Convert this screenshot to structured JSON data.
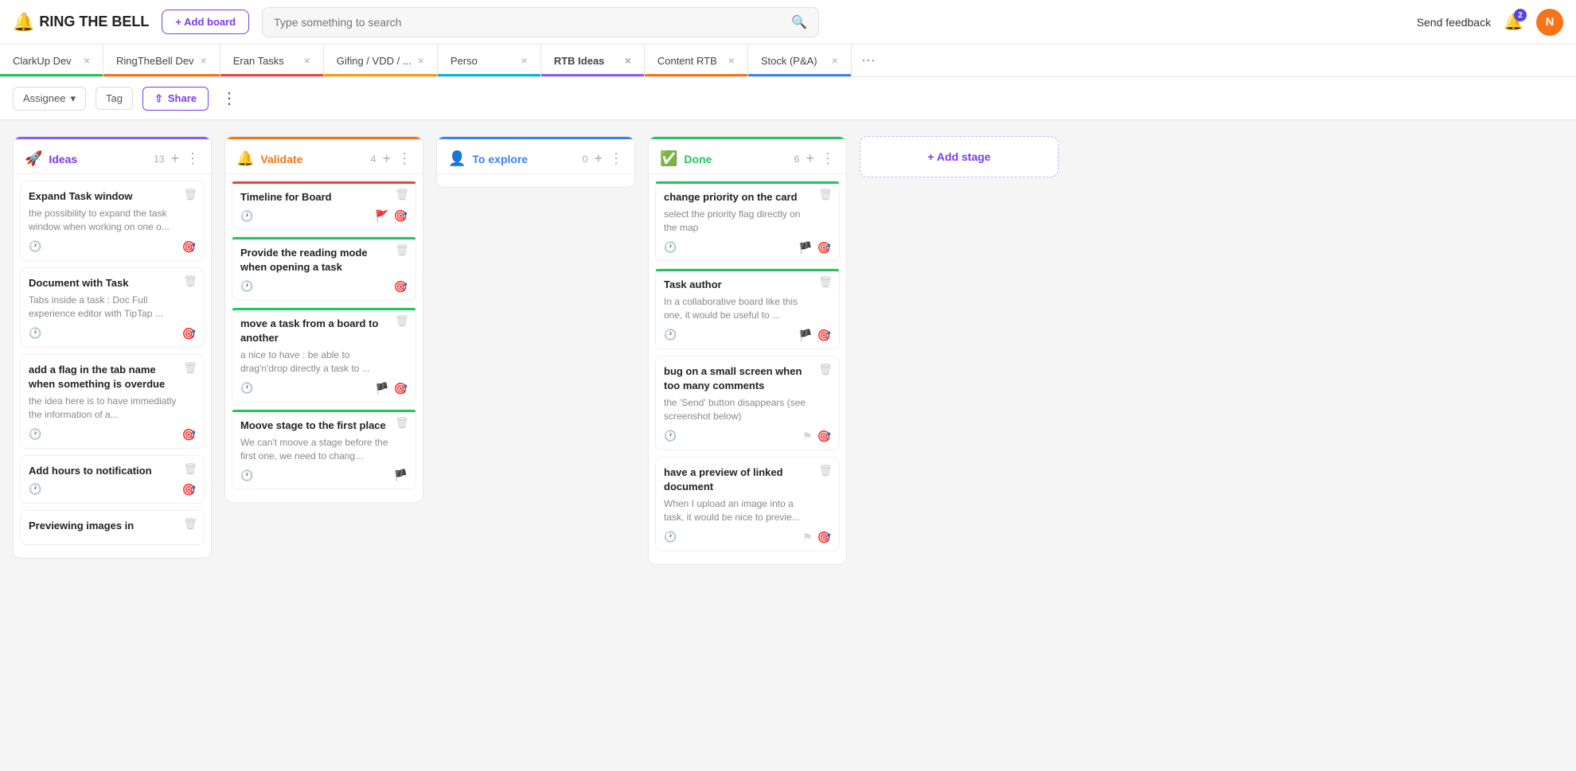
{
  "topbar": {
    "logo_text": "RING THE BELL",
    "add_board_label": "+ Add board",
    "search_placeholder": "Type something to search",
    "feedback_label": "Send feedback",
    "notif_count": "2",
    "avatar_initial": "N"
  },
  "tabs": [
    {
      "id": "clarkup",
      "label": "ClarkUp Dev",
      "color": "#22c55e",
      "active": false
    },
    {
      "id": "rtb-dev",
      "label": "RingTheBell Dev",
      "color": "#f97316",
      "active": false
    },
    {
      "id": "eran",
      "label": "Eran Tasks",
      "color": "#ef4444",
      "active": false
    },
    {
      "id": "gifing",
      "label": "Gifing / VDD / ...",
      "color": "#f59e0b",
      "active": false
    },
    {
      "id": "perso",
      "label": "Perso",
      "color": "#06b6d4",
      "active": false
    },
    {
      "id": "rtb-ideas",
      "label": "RTB Ideas",
      "color": "#8b5cf6",
      "active": true
    },
    {
      "id": "content",
      "label": "Content RTB",
      "color": "#f97316",
      "active": false
    },
    {
      "id": "stock",
      "label": "Stock (P&A)",
      "color": "#3b82f6",
      "active": false
    }
  ],
  "toolbar": {
    "assignee_label": "Assignee",
    "tag_label": "Tag",
    "share_label": "Share"
  },
  "columns": [
    {
      "id": "ideas",
      "title": "Ideas",
      "title_color": "purple",
      "icon": "🚀",
      "count": "13",
      "top_bar_color": "#8b5cf6",
      "cards": [
        {
          "id": "c1",
          "title": "Expand Task window",
          "desc": "the possibility to expand the task window when working on one o...",
          "top_bar_color": null,
          "flag": null,
          "has_clock": true,
          "has_target": true
        },
        {
          "id": "c2",
          "title": "Document with Task",
          "desc": "Tabs inside a task : Doc Full experience editor with TipTap ...",
          "top_bar_color": null,
          "flag": null,
          "has_clock": true,
          "has_target": true
        },
        {
          "id": "c3",
          "title": "add a flag in the tab name when something is overdue",
          "desc": "the idea here is to have immediatly the information of a...",
          "top_bar_color": null,
          "flag": null,
          "has_clock": true,
          "has_target": true
        },
        {
          "id": "c4",
          "title": "Add hours to notification",
          "desc": "",
          "top_bar_color": null,
          "flag": null,
          "has_clock": true,
          "has_target": true
        },
        {
          "id": "c5",
          "title": "Previewing images in",
          "desc": "",
          "top_bar_color": null,
          "flag": null,
          "has_clock": false,
          "has_target": false
        }
      ]
    },
    {
      "id": "validate",
      "title": "Validate",
      "title_color": "orange",
      "icon": "🔔",
      "count": "4",
      "top_bar_color": "#f97316",
      "cards": [
        {
          "id": "v1",
          "title": "Timeline for Board",
          "desc": "",
          "top_bar_color": "#ef4444",
          "flag": "red",
          "has_clock": true,
          "has_target": true
        },
        {
          "id": "v2",
          "title": "Provide the reading mode when opening a task",
          "desc": "",
          "top_bar_color": "#22c55e",
          "flag": null,
          "has_clock": true,
          "has_target": true
        },
        {
          "id": "v3",
          "title": "move a task from a board to another",
          "desc": "a nice to have : be able to drag'n'drop directly a task to ...",
          "top_bar_color": "#22c55e",
          "flag": "green",
          "has_clock": true,
          "has_target": true
        },
        {
          "id": "v4",
          "title": "Moove stage to the first place",
          "desc": "We can't moove a stage before the first one, we need to chang...",
          "top_bar_color": "#22c55e",
          "flag": "green",
          "has_clock": true,
          "has_target": false
        }
      ]
    },
    {
      "id": "to-explore",
      "title": "To explore",
      "title_color": "blue",
      "icon": "👤",
      "count": "0",
      "top_bar_color": "#3b82f6",
      "cards": []
    },
    {
      "id": "done",
      "title": "Done",
      "title_color": "green",
      "icon": "✅",
      "count": "6",
      "top_bar_color": "#22c55e",
      "cards": [
        {
          "id": "d1",
          "title": "change priority on the card",
          "desc": "select the priority flag directly on the map",
          "top_bar_color": "#22c55e",
          "flag": "green",
          "has_clock": true,
          "has_target": true
        },
        {
          "id": "d2",
          "title": "Task author",
          "desc": "In a collaborative board like this one, it would be useful to ...",
          "top_bar_color": "#22c55e",
          "flag": "green",
          "has_clock": true,
          "has_target": true
        },
        {
          "id": "d3",
          "title": "bug on a small screen when too many comments",
          "desc": "the 'Send' button disappears (see screenshot below)",
          "top_bar_color": null,
          "flag": "gray",
          "has_clock": true,
          "has_target": true
        },
        {
          "id": "d4",
          "title": "have a preview of linked document",
          "desc": "When I upload an image into a task, it would be nice to previe...",
          "top_bar_color": null,
          "flag": "gray",
          "has_clock": true,
          "has_target": true
        }
      ]
    }
  ],
  "add_stage_label": "+ Add stage"
}
